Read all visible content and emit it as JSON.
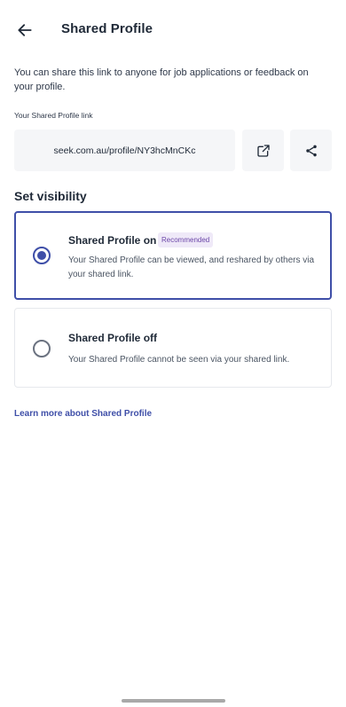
{
  "header": {
    "title": "Shared Profile",
    "back_icon": "arrow-left-icon"
  },
  "intro": {
    "text": "You can share this link to anyone for job applications or feedback on your profile."
  },
  "link": {
    "label": "Your Shared Profile link",
    "url": "seek.com.au/profile/NY3hcMnCKc",
    "open_icon": "open-in-new-icon",
    "share_icon": "share-icon"
  },
  "visibility": {
    "title": "Set visibility",
    "options": [
      {
        "title": "Shared Profile on",
        "badge": "Recommended",
        "description": "Your Shared Profile can be viewed, and reshared by others via your shared link.",
        "selected": true
      },
      {
        "title": "Shared Profile off",
        "description": "Your Shared Profile cannot be seen via your shared link.",
        "selected": false
      }
    ]
  },
  "learn_more": {
    "label": "Learn more about Shared Profile"
  },
  "colors": {
    "accent": "#3f4fa8",
    "badge_bg": "#efe9f8",
    "badge_text": "#6b46a8",
    "surface": "#f5f6f8"
  }
}
